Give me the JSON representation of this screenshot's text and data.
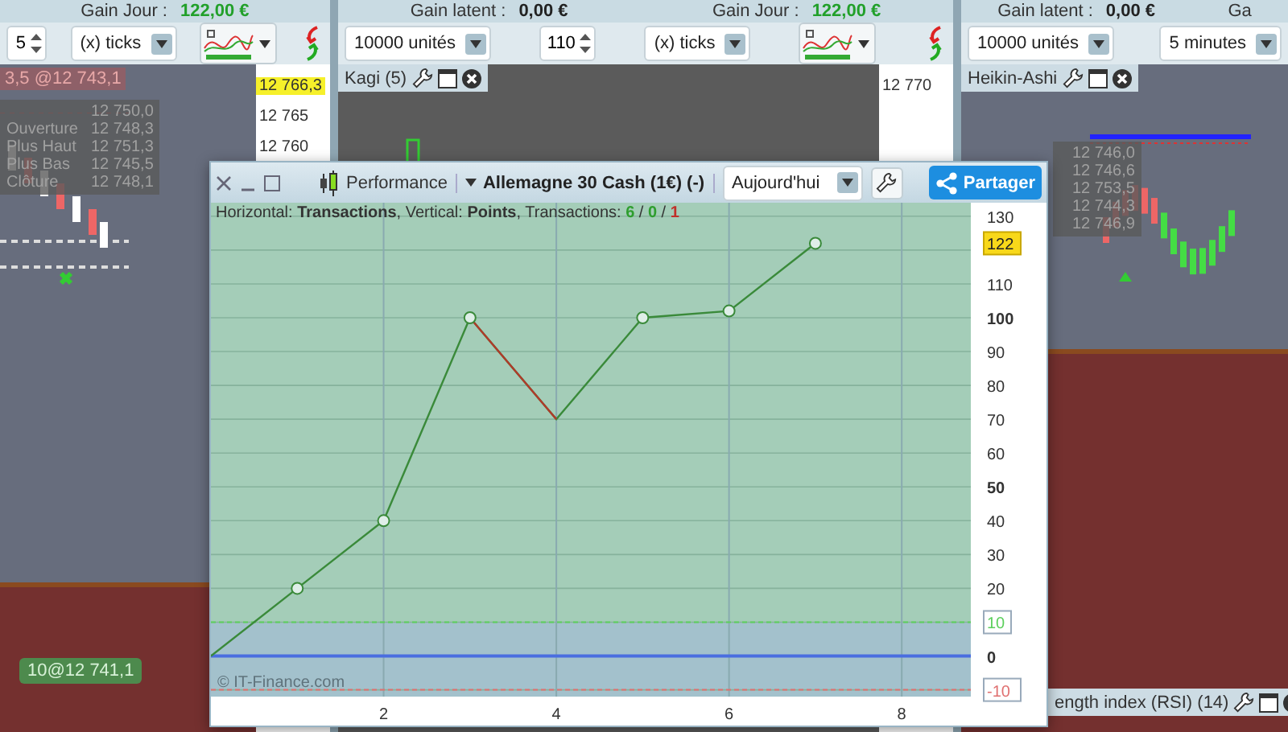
{
  "panels": [
    {
      "gains": [
        {
          "label": "Gain Jour :",
          "value": "122,00 €",
          "kind": "positive"
        }
      ],
      "toolbar": [
        {
          "kind": "spinner",
          "value": "5"
        },
        {
          "kind": "select",
          "value": "(x) ticks"
        },
        {
          "kind": "indicator"
        },
        {
          "kind": "flip"
        }
      ],
      "chart": {
        "kind": "candles",
        "axis": [
          {
            "label": "12 766,3",
            "kind": "current"
          },
          {
            "label": "12 765",
            "kind": "tick"
          },
          {
            "label": "12 760",
            "kind": "tick"
          }
        ],
        "order_top": "3,5 @12 743,1",
        "tooltip": [
          {
            "value": "12 750,0"
          },
          {
            "label": "Ouverture",
            "value": "12 748,3"
          },
          {
            "label": "Plus Haut",
            "value": "12 751,3"
          },
          {
            "label": "Plus Bas",
            "value": "12 745,5"
          },
          {
            "label": "Clôture",
            "value": "12 748,1"
          }
        ],
        "order_badge": "10@12 741,1"
      }
    },
    {
      "gains": [
        {
          "label": "Gain latent :",
          "value": "0,00 €",
          "kind": "neutral"
        },
        {
          "label": "Gain Jour :",
          "value": "122,00 €",
          "kind": "positive"
        }
      ],
      "toolbar": [
        {
          "kind": "select",
          "value": "10000 unités"
        },
        {
          "kind": "spinner",
          "value": "110"
        },
        {
          "kind": "select",
          "value": "(x) ticks"
        },
        {
          "kind": "indicator"
        },
        {
          "kind": "flip"
        }
      ],
      "chart": {
        "kind": "kagi",
        "tabs": [
          {
            "label": "Kagi (5)"
          }
        ],
        "axis": [
          {
            "label": "12 770",
            "kind": "tick"
          }
        ]
      }
    },
    {
      "gains": [
        {
          "label": "Gain latent :",
          "value": "0,00 €",
          "kind": "neutral"
        },
        {
          "label": "Ga"
        }
      ],
      "toolbar": [
        {
          "kind": "select",
          "value": "10000 unités"
        },
        {
          "kind": "select",
          "value": "5 minutes"
        }
      ],
      "chart": {
        "kind": "heikin",
        "tabs": [
          {
            "label": "Heikin-Ashi"
          }
        ],
        "bottom_tab": "ength index (RSI) (14)",
        "tooltip": [
          {
            "value": "12 746,0"
          },
          {
            "value": "12 746,6"
          },
          {
            "value": "12 753,5"
          },
          {
            "value": "12 744,3"
          },
          {
            "value": "12 746,9"
          }
        ]
      }
    }
  ],
  "window": {
    "title": "Performance",
    "instrument": "Allemagne 30 Cash (1€) (-)",
    "period": "Aujourd'hui",
    "share": "Partager",
    "info": {
      "text": "Horizontal: **Transactions**, Vertical: **Points**, Transactions: ",
      "separator": " / ",
      "counts": [
        {
          "value": "6",
          "color": "#2e9e2e"
        },
        {
          "value": "0",
          "color": "#2e9e2e"
        },
        {
          "value": "1",
          "color": "#c0302a"
        }
      ]
    },
    "copyright": "© IT-Finance.com",
    "chart_data": {
      "type": "line",
      "x": [
        0,
        1,
        2,
        3,
        4,
        5,
        6,
        7
      ],
      "series": [
        {
          "color": "#3a8a3a",
          "values": [
            0,
            20,
            40,
            100,
            70,
            100,
            102,
            122
          ]
        }
      ],
      "xlim": [
        0,
        8.8
      ],
      "ylim": [
        -12,
        134
      ],
      "xticks": [
        2,
        4,
        6,
        8
      ],
      "yticks": [
        130,
        110,
        {
          "value": 100,
          "label": "100"
        },
        90,
        80,
        70,
        60,
        {
          "value": 50,
          "label": "50"
        },
        40,
        30,
        20,
        {
          "value": 0,
          "label": "0"
        }
      ],
      "grid": true,
      "ref_lines": [
        {
          "axis": "y",
          "value": 10,
          "color": "#5ccf5c"
        },
        {
          "axis": "y",
          "value": 0,
          "color": "#4a6ee0"
        },
        {
          "axis": "y",
          "value": -10,
          "color": "#e07070"
        }
      ],
      "bands": [
        {
          "axis": "y",
          "from": -12,
          "to": 10,
          "color": "#a3c1cc"
        }
      ],
      "annotations": [
        "122",
        "10",
        "-10"
      ]
    }
  }
}
